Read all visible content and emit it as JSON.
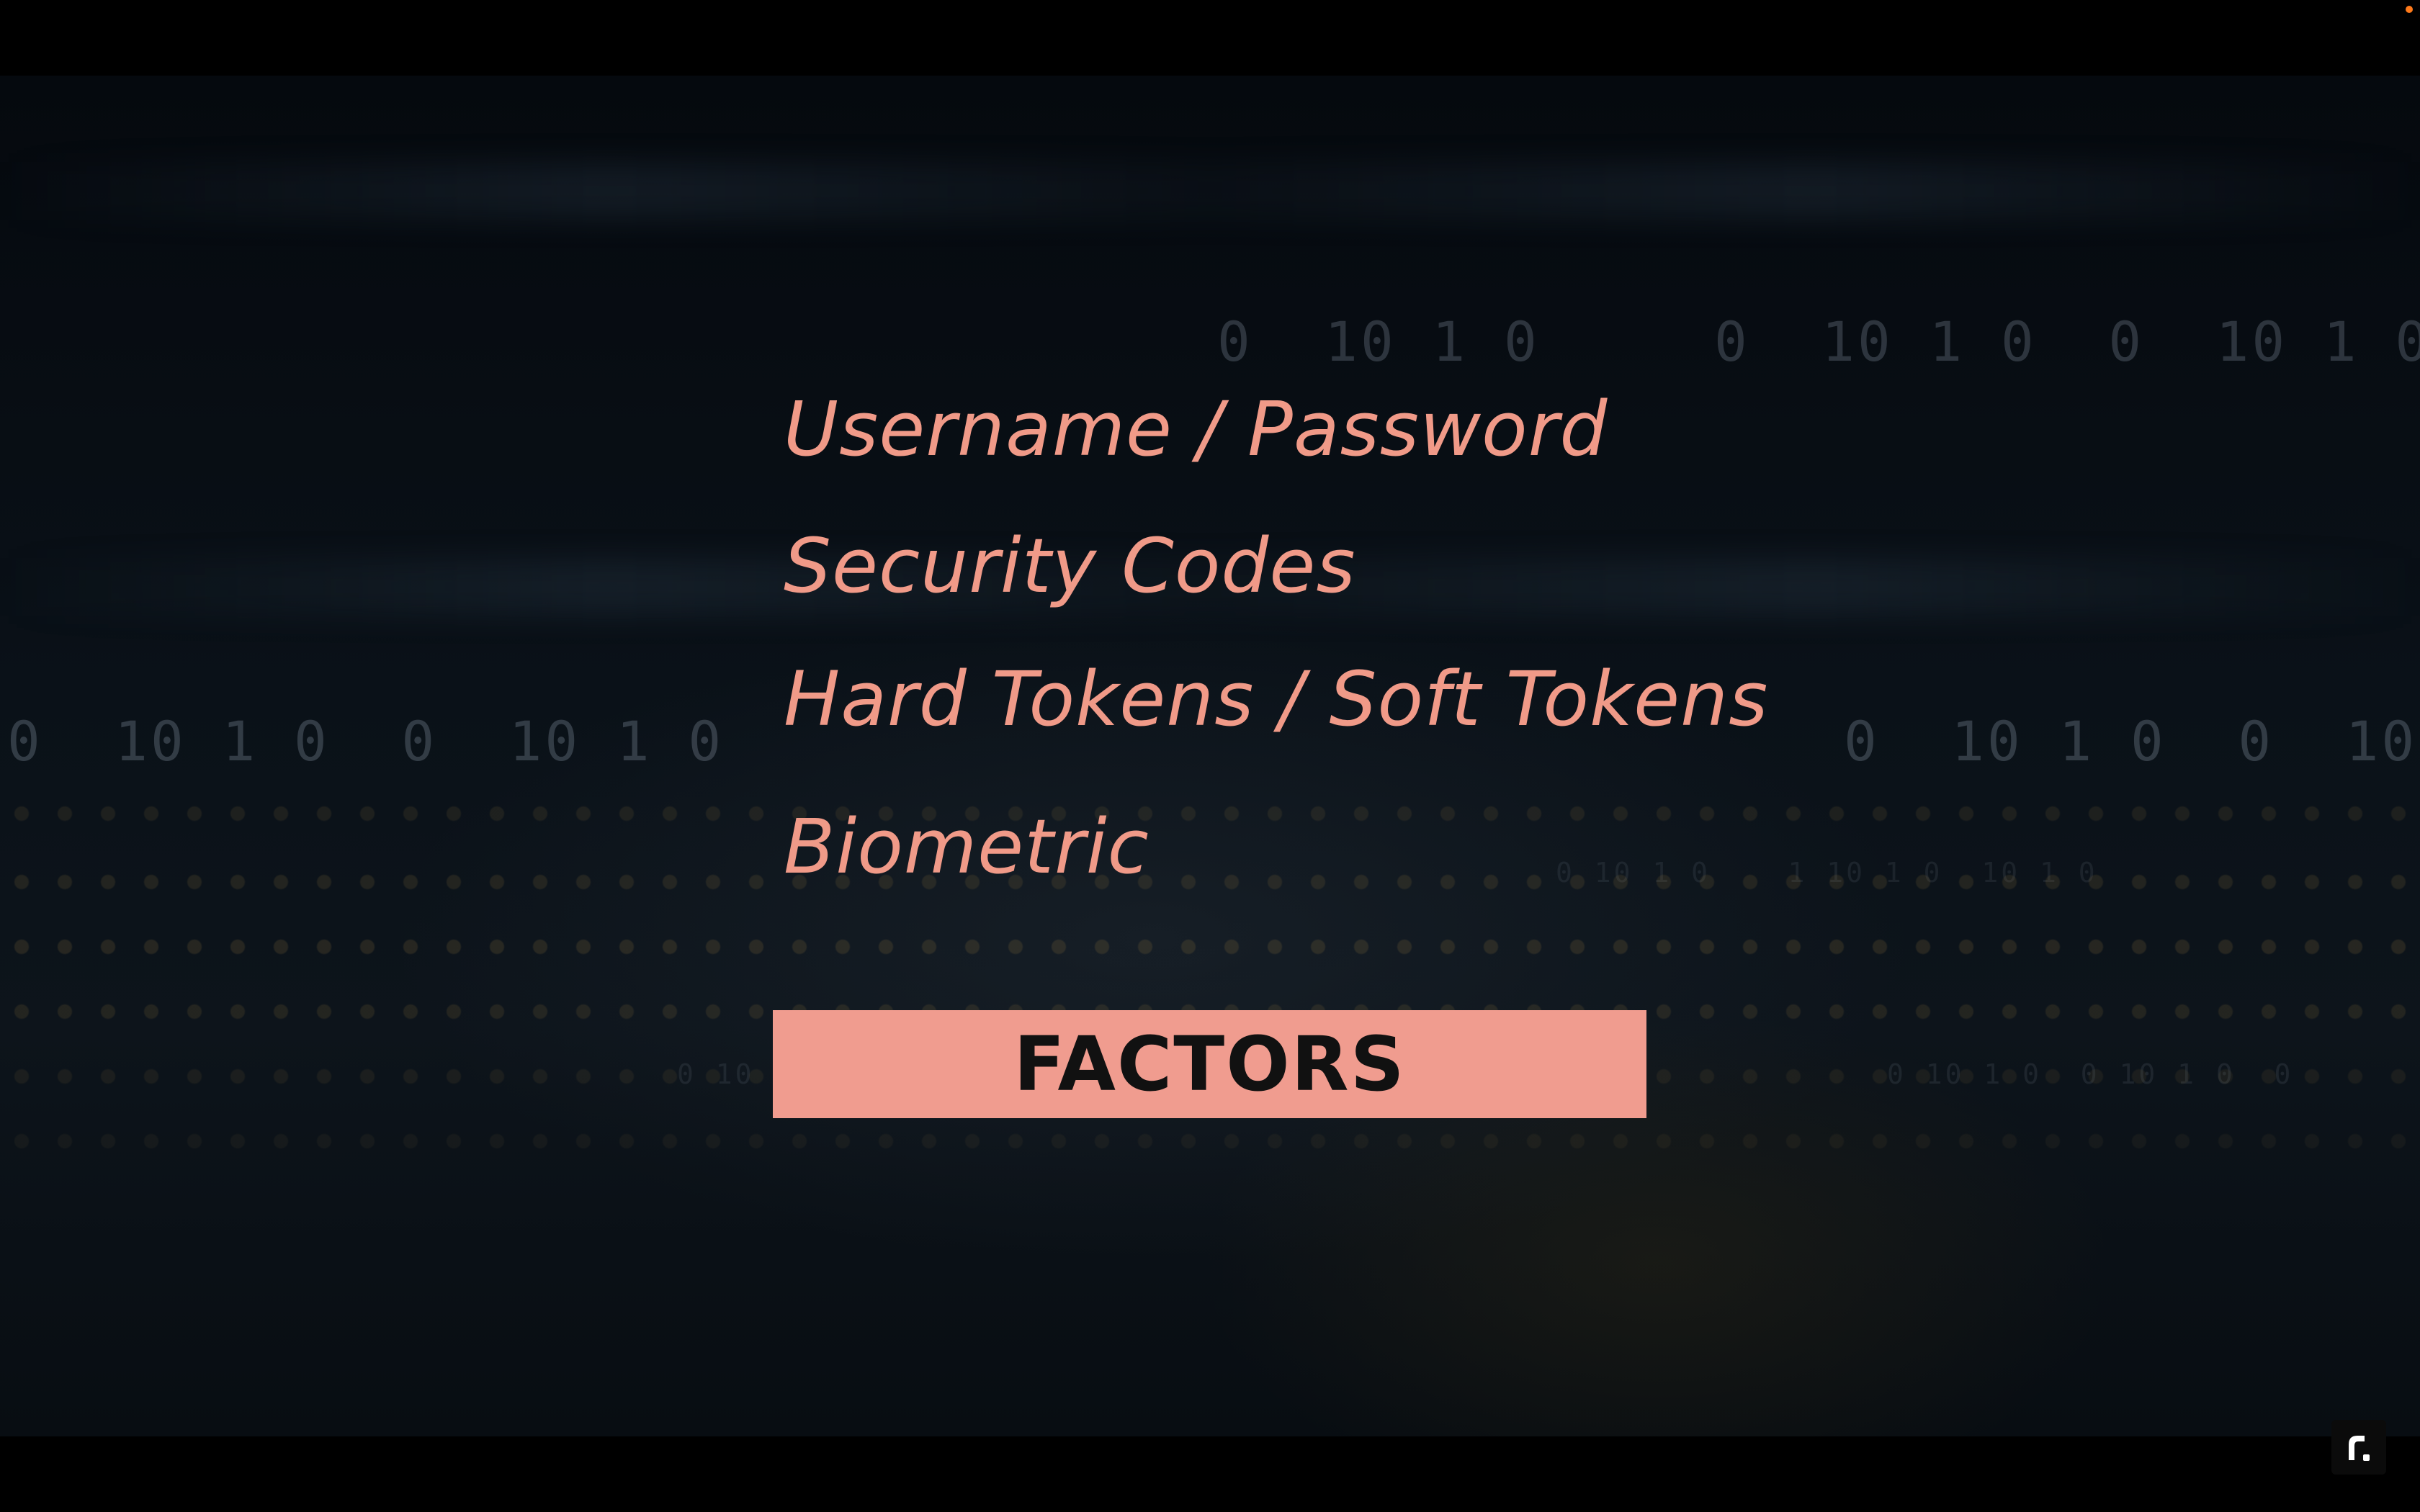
{
  "slide": {
    "factor_items": [
      "Username / Password",
      "Security Codes",
      "Hard Tokens / Soft Tokens",
      "Biometric"
    ],
    "banner_label": "FACTORS"
  },
  "background": {
    "binary_rows": [
      "0  10 1 0",
      "0  10 1 0  0  10 1 0",
      "0  10 1 0  0  10 1 0",
      "0  10 1 0  0  10 1",
      "0 10 1 0    1 10 1 0  10 1 0",
      "0 10 1 0  0 10 1 0  0 10 1 0",
      "0 10 1 0  0 10 1 0  0"
    ]
  },
  "watermark": {
    "icon": "player-logo-icon"
  },
  "colors": {
    "text_accent": "#f09a88",
    "banner_fill": "#f09c8f",
    "banner_text": "#111111",
    "background": "#0a1118",
    "indicator": "#ff7a1a"
  }
}
